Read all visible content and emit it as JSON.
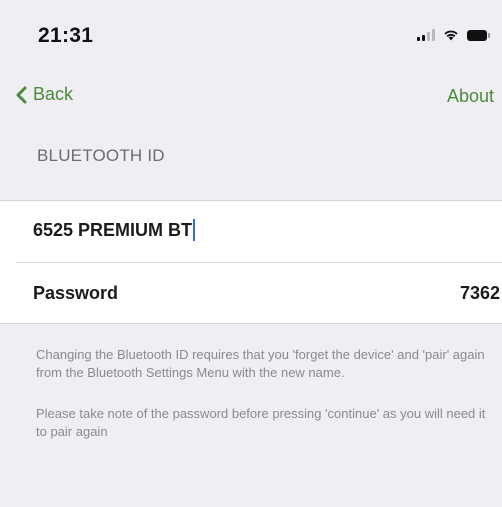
{
  "status_bar": {
    "time": "21:31",
    "icons": [
      "cellular-signal-icon",
      "wifi-icon",
      "battery-icon"
    ]
  },
  "nav": {
    "back_label": "Back",
    "about_label": "About",
    "accent_color": "#4c8a3a"
  },
  "section": {
    "header": "BLUETOOTH ID"
  },
  "form": {
    "bluetooth_id_value": "6525 PREMIUM BT",
    "password_label": "Password",
    "password_value": "7362"
  },
  "notes": {
    "change_id": "Changing the Bluetooth ID requires that you 'forget the device' and 'pair' again from the Bluetooth Settings Menu with the new name.",
    "password": "Please take note of the password before pressing 'continue' as you will need it to pair again"
  }
}
